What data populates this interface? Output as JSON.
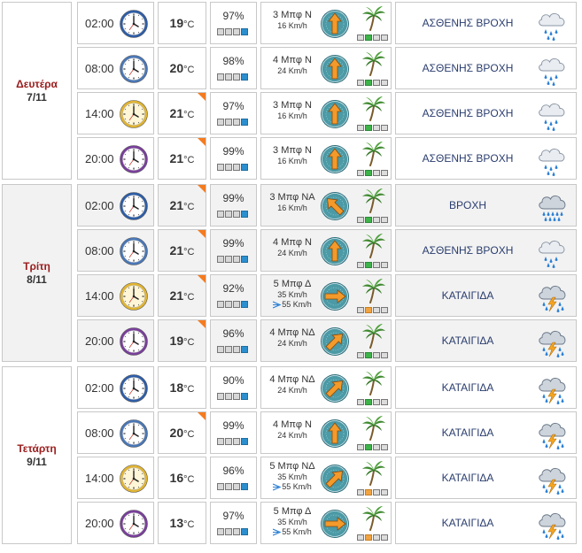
{
  "units": {
    "temp": "°C"
  },
  "days": [
    {
      "name": "Δευτέρα",
      "date": "7/11",
      "rows": [
        {
          "time": "02:00",
          "temp": "19",
          "hum": "97%",
          "hum_level": 5,
          "beaufort": "3 Μπφ Ν",
          "kmh": "16 Km/h",
          "gust": "",
          "dir_deg": 0,
          "wind_level": 2,
          "wind_color": "green",
          "cond": "ΑΣΘΕΝΗΣ ΒΡΟΧΗ",
          "icon": "light-rain",
          "clock": "night",
          "flag": false
        },
        {
          "time": "08:00",
          "temp": "20",
          "hum": "98%",
          "hum_level": 5,
          "beaufort": "4 Μπφ Ν",
          "kmh": "24 Km/h",
          "gust": "",
          "dir_deg": 0,
          "wind_level": 2,
          "wind_color": "green",
          "cond": "ΑΣΘΕΝΗΣ ΒΡΟΧΗ",
          "icon": "light-rain",
          "clock": "morning",
          "flag": false
        },
        {
          "time": "14:00",
          "temp": "21",
          "hum": "97%",
          "hum_level": 5,
          "beaufort": "3 Μπφ Ν",
          "kmh": "16 Km/h",
          "gust": "",
          "dir_deg": 0,
          "wind_level": 2,
          "wind_color": "green",
          "cond": "ΑΣΘΕΝΗΣ ΒΡΟΧΗ",
          "icon": "light-rain",
          "clock": "noon",
          "flag": true
        },
        {
          "time": "20:00",
          "temp": "21",
          "hum": "99%",
          "hum_level": 5,
          "beaufort": "3 Μπφ Ν",
          "kmh": "16 Km/h",
          "gust": "",
          "dir_deg": 0,
          "wind_level": 2,
          "wind_color": "green",
          "cond": "ΑΣΘΕΝΗΣ ΒΡΟΧΗ",
          "icon": "light-rain",
          "clock": "evening",
          "flag": true
        }
      ]
    },
    {
      "name": "Τρίτη",
      "date": "8/11",
      "rows": [
        {
          "time": "02:00",
          "temp": "21",
          "hum": "99%",
          "hum_level": 5,
          "beaufort": "3 Μπφ ΝΑ",
          "kmh": "16 Km/h",
          "gust": "",
          "dir_deg": -45,
          "wind_level": 2,
          "wind_color": "green",
          "cond": "ΒΡΟΧΗ",
          "icon": "rain",
          "clock": "night",
          "flag": true
        },
        {
          "time": "08:00",
          "temp": "21",
          "hum": "99%",
          "hum_level": 5,
          "beaufort": "4 Μπφ Ν",
          "kmh": "24 Km/h",
          "gust": "",
          "dir_deg": 0,
          "wind_level": 2,
          "wind_color": "green",
          "cond": "ΑΣΘΕΝΗΣ ΒΡΟΧΗ",
          "icon": "light-rain",
          "clock": "morning",
          "flag": true
        },
        {
          "time": "14:00",
          "temp": "21",
          "hum": "92%",
          "hum_level": 5,
          "beaufort": "5 Μπφ Δ",
          "kmh": "35 Km/h",
          "gust": "55 Km/h",
          "dir_deg": 90,
          "wind_level": 2,
          "wind_color": "orange",
          "cond": "ΚΑΤΑΙΓΙΔΑ",
          "icon": "storm",
          "clock": "noon",
          "flag": true
        },
        {
          "time": "20:00",
          "temp": "19",
          "hum": "96%",
          "hum_level": 5,
          "beaufort": "4 Μπφ ΝΔ",
          "kmh": "24 Km/h",
          "gust": "",
          "dir_deg": 45,
          "wind_level": 2,
          "wind_color": "green",
          "cond": "ΚΑΤΑΙΓΙΔΑ",
          "icon": "storm",
          "clock": "evening",
          "flag": true
        }
      ]
    },
    {
      "name": "Τετάρτη",
      "date": "9/11",
      "rows": [
        {
          "time": "02:00",
          "temp": "18",
          "hum": "90%",
          "hum_level": 5,
          "beaufort": "4 Μπφ ΝΔ",
          "kmh": "24 Km/h",
          "gust": "",
          "dir_deg": 45,
          "wind_level": 2,
          "wind_color": "green",
          "cond": "ΚΑΤΑΙΓΙΔΑ",
          "icon": "storm",
          "clock": "night",
          "flag": false
        },
        {
          "time": "08:00",
          "temp": "20",
          "hum": "99%",
          "hum_level": 5,
          "beaufort": "4 Μπφ Ν",
          "kmh": "24 Km/h",
          "gust": "",
          "dir_deg": 0,
          "wind_level": 2,
          "wind_color": "green",
          "cond": "ΚΑΤΑΙΓΙΔΑ",
          "icon": "storm",
          "clock": "morning",
          "flag": true
        },
        {
          "time": "14:00",
          "temp": "16",
          "hum": "96%",
          "hum_level": 5,
          "beaufort": "5 Μπφ ΝΔ",
          "kmh": "35 Km/h",
          "gust": "55 Km/h",
          "dir_deg": 45,
          "wind_level": 2,
          "wind_color": "orange",
          "cond": "ΚΑΤΑΙΓΙΔΑ",
          "icon": "storm",
          "clock": "noon",
          "flag": false
        },
        {
          "time": "20:00",
          "temp": "13",
          "hum": "97%",
          "hum_level": 5,
          "beaufort": "5 Μπφ Δ",
          "kmh": "35 Km/h",
          "gust": "55 Km/h",
          "dir_deg": 90,
          "wind_level": 2,
          "wind_color": "orange",
          "cond": "ΚΑΤΑΙΓΙΔΑ",
          "icon": "storm",
          "clock": "evening",
          "flag": false
        }
      ]
    }
  ],
  "colors": {
    "day_name": "#9a1c1c",
    "flag": "#f47c20",
    "humidity_bar": "#2b8fcf",
    "wind_green": "#3db34a",
    "wind_orange": "#f1a342",
    "compass": "#3f8f9b",
    "arrow": "#f39a2b",
    "condition_text": "#2a3d6e"
  }
}
